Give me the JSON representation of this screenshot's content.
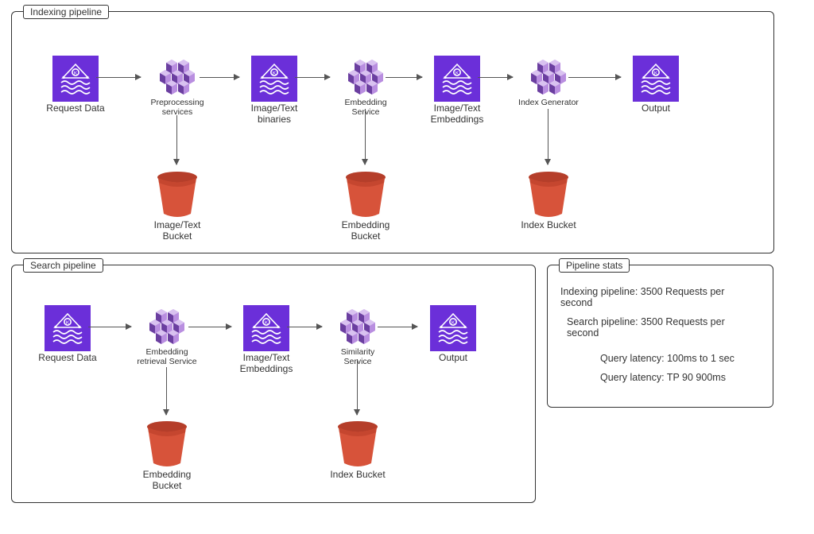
{
  "panels": {
    "indexing": {
      "title": "Indexing pipeline"
    },
    "search": {
      "title": "Search pipeline"
    },
    "stats": {
      "title": "Pipeline stats"
    }
  },
  "indexing": {
    "request": "Request Data",
    "preproc": "Preprocessing services",
    "binaries": "Image/Text binaries",
    "embed_svc": "Embedding Service",
    "embeddings": "Image/Text Embeddings",
    "index_gen": "Index Generator",
    "output": "Output",
    "img_bucket": "Image/Text Bucket",
    "emb_bucket": "Embedding Bucket",
    "idx_bucket": "Index Bucket"
  },
  "search": {
    "request": "Request Data",
    "retrieval": "Embedding retrieval Service",
    "embeddings": "Image/Text Embeddings",
    "sim_svc": "Similarity Service",
    "output": "Output",
    "emb_bucket": "Embedding Bucket",
    "idx_bucket": "Index Bucket"
  },
  "stats": {
    "line1": "Indexing pipeline: 3500 Requests per second",
    "line2": "Search pipeline: 3500 Requests per second",
    "line3": "Query latency: 100ms to 1 sec",
    "line4": "Query latency: TP 90 900ms"
  },
  "colors": {
    "purple": "#6b2fd9",
    "cube_dark": "#6b3fa0",
    "cube_light": "#b98ee0",
    "bucket": "#d7533a"
  }
}
